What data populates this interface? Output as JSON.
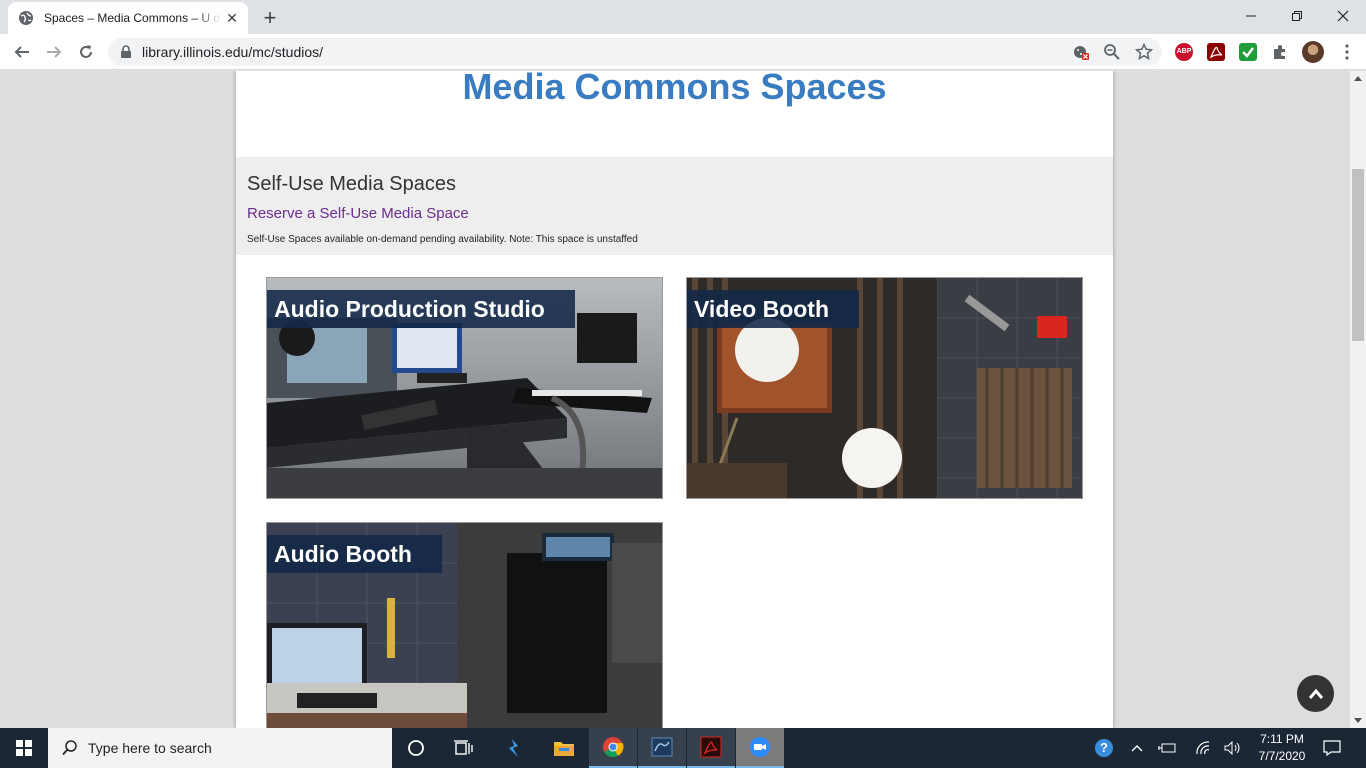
{
  "browser": {
    "tab_title": "Spaces – Media Commons – U of I Library",
    "url": "library.illinois.edu/mc/studios/"
  },
  "page": {
    "title": "Media Commons Spaces",
    "section": {
      "heading": "Self-Use Media Spaces",
      "link": "Reserve a Self-Use Media Space",
      "note": "Self-Use Spaces available on-demand pending availability. Note: This space is unstaffed"
    },
    "cards": [
      {
        "label": "Audio Production Studio"
      },
      {
        "label": "Video Booth"
      },
      {
        "label": "Audio Booth"
      }
    ]
  },
  "taskbar": {
    "search_placeholder": "Type here to search",
    "time": "7:11 PM",
    "date": "7/7/2020"
  },
  "colors": {
    "title_blue": "#3a7cc1",
    "link_purple": "#6b2d8f",
    "taskbar": "#1b2735"
  }
}
